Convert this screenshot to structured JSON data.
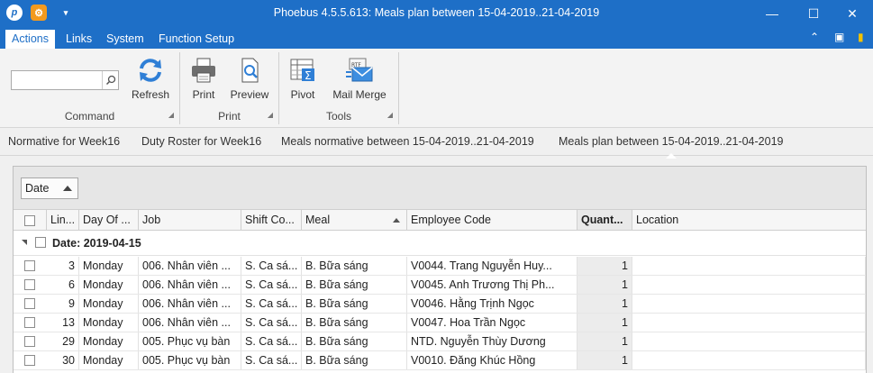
{
  "window": {
    "title": "Phoebus 4.5.5.613: Meals plan between 15-04-2019..21-04-2019",
    "app_icon_letter": "p",
    "minimize": "—",
    "maximize": "☐",
    "close": "✕"
  },
  "menu": {
    "tabs": [
      "Actions",
      "Links",
      "System",
      "Function Setup"
    ],
    "active": "Actions"
  },
  "ribbon": {
    "search": {
      "value": "",
      "placeholder": ""
    },
    "refresh_label": "Refresh",
    "print_label": "Print",
    "preview_label": "Preview",
    "pivot_label": "Pivot",
    "mail_merge_label": "Mail Merge",
    "group_command": "Command",
    "group_print": "Print",
    "group_tools": "Tools"
  },
  "doc_tabs": [
    "Normative for Week16",
    "Duty Roster for Week16",
    "Meals normative between 15-04-2019..21-04-2019",
    "Meals plan between 15-04-2019..21-04-2019"
  ],
  "grid": {
    "group_chip": "Date",
    "columns": [
      "Lin...",
      "Day Of ...",
      "Job",
      "Shift Co...",
      "Meal",
      "Employee Code",
      "Quant...",
      "Location"
    ],
    "group_row": "Date: 2019-04-15",
    "rows": [
      {
        "line": "3",
        "day": "Monday",
        "job": "006. Nhân viên ...",
        "shift": "S. Ca sá...",
        "meal": "B. Bữa sáng",
        "employee": "V0044. Trang  Nguyễn Huy...",
        "qty": "1",
        "location": ""
      },
      {
        "line": "6",
        "day": "Monday",
        "job": "006. Nhân viên ...",
        "shift": "S. Ca sá...",
        "meal": "B. Bữa sáng",
        "employee": "V0045. Anh  Trương Thị Ph...",
        "qty": "1",
        "location": ""
      },
      {
        "line": "9",
        "day": "Monday",
        "job": "006. Nhân viên ...",
        "shift": "S. Ca sá...",
        "meal": "B. Bữa sáng",
        "employee": "V0046. Hằng  Trịnh Ngọc",
        "qty": "1",
        "location": ""
      },
      {
        "line": "13",
        "day": "Monday",
        "job": "006. Nhân viên ...",
        "shift": "S. Ca sá...",
        "meal": "B. Bữa sáng",
        "employee": "V0047. Hoa  Trần Ngọc",
        "qty": "1",
        "location": ""
      },
      {
        "line": "29",
        "day": "Monday",
        "job": "005. Phục vụ bàn",
        "shift": "S. Ca sá...",
        "meal": "B. Bữa sáng",
        "employee": "NTD. Nguyễn Thùy  Dương",
        "qty": "1",
        "location": ""
      },
      {
        "line": "30",
        "day": "Monday",
        "job": "005. Phục vụ bàn",
        "shift": "S. Ca sá...",
        "meal": "B. Bữa sáng",
        "employee": "V0010. Đăng  Khúc Hồng",
        "qty": "1",
        "location": ""
      }
    ]
  }
}
